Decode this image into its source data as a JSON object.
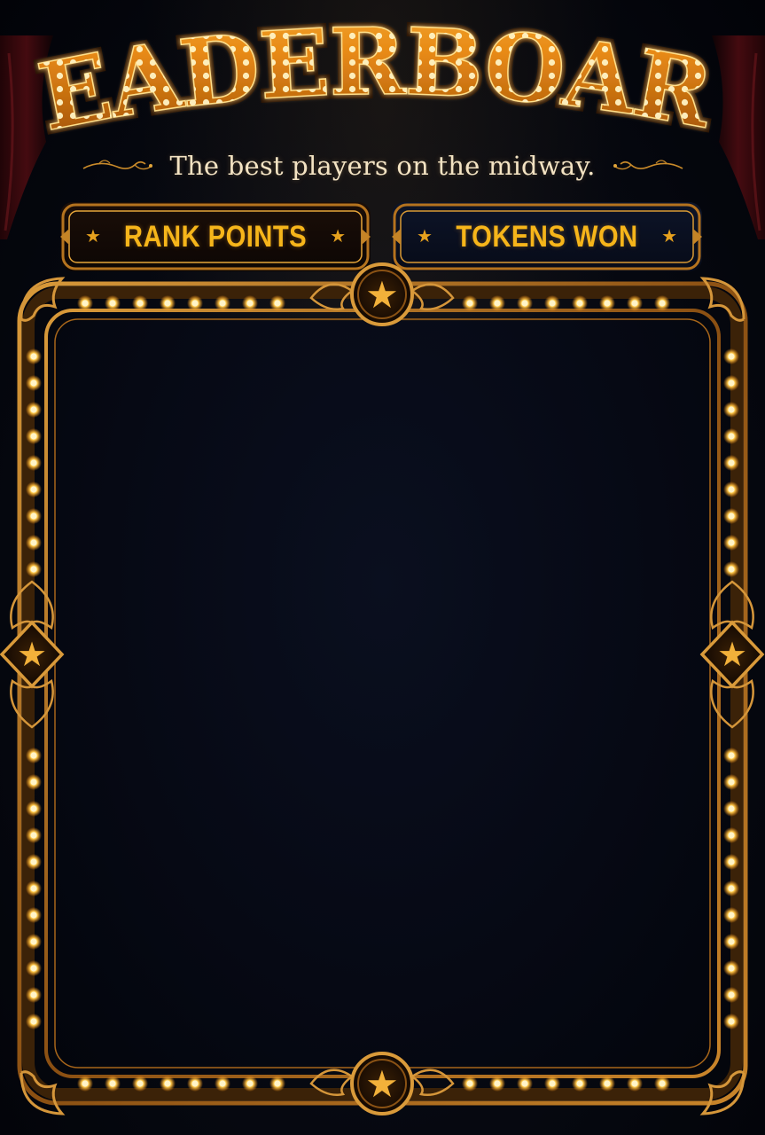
{
  "header": {
    "title": "LEADERBOARD",
    "subtitle": "The best players on the midway."
  },
  "tabs": [
    {
      "label": "RANK POINTS",
      "active": true
    },
    {
      "label": "TOKENS WON",
      "active": false
    }
  ],
  "board": {
    "entries": []
  },
  "colors": {
    "gold": "#f6b51a",
    "bulb": "#ffd46a",
    "frame": "#b5731e",
    "background": "#05070f",
    "curtain": "#5a0d12"
  },
  "icons": {
    "top_ornament": "star-icon",
    "bottom_ornament": "star-icon",
    "side_ornament": "star-icon",
    "tab_decor": "star-icon"
  }
}
